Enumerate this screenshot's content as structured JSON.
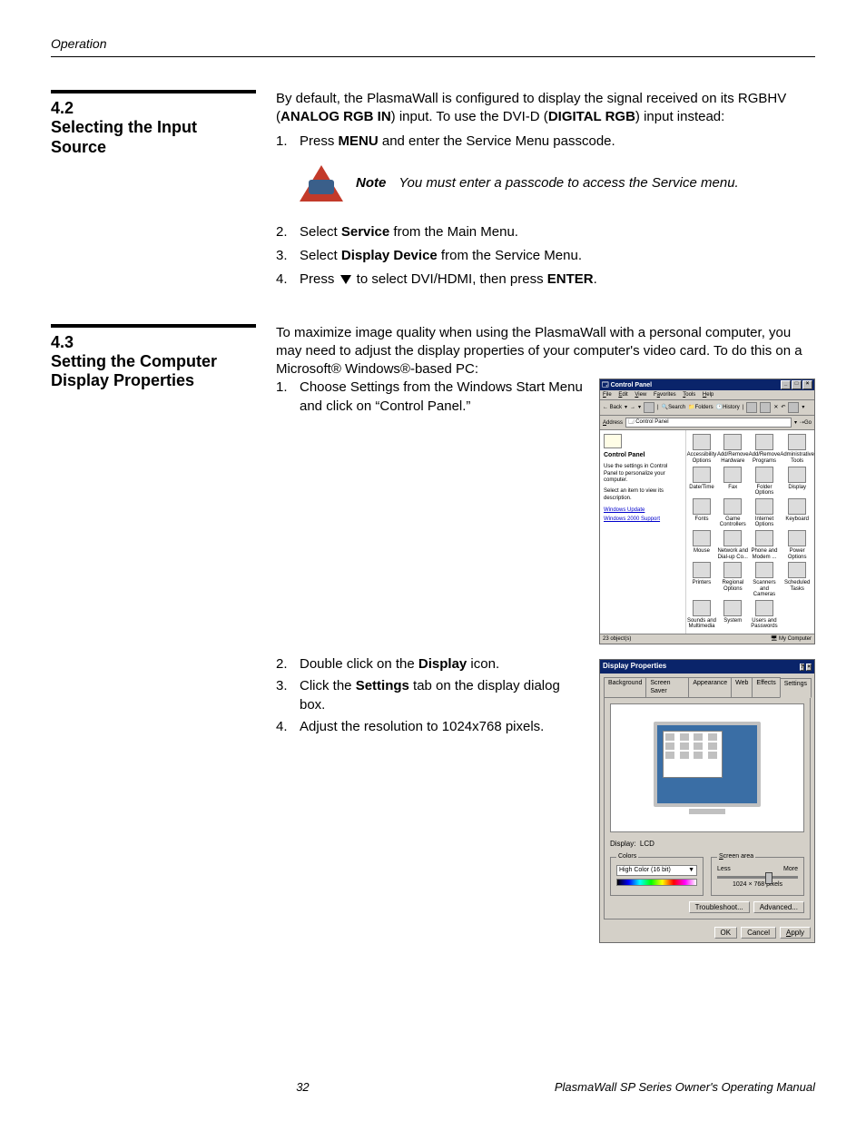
{
  "header": {
    "section": "Operation"
  },
  "sec42": {
    "num": "4.2",
    "title": "Selecting the Input Source",
    "intro_a": "By default, the PlasmaWall is configured to display the signal received on its RGBHV (",
    "intro_b": "ANALOG RGB IN",
    "intro_c": ") input. To use the DVI-D (",
    "intro_d": "DIGITAL RGB",
    "intro_e": ") input instead:",
    "step1_a": "Press ",
    "step1_b": "MENU",
    "step1_c": " and enter the Service Menu passcode.",
    "note_label": "Note",
    "note_text": "You must enter a passcode to access the Service menu.",
    "step2_a": "Select ",
    "step2_b": "Service",
    "step2_c": " from the Main Menu.",
    "step3_a": "Select ",
    "step3_b": "Display Device",
    "step3_c": " from the Service Menu.",
    "step4_a": "Press ",
    "step4_b": " to select DVI/HDMI, then press ",
    "step4_c": "ENTER",
    "step4_d": "."
  },
  "sec43": {
    "num": "4.3",
    "title": "Setting the Computer Display Properties",
    "intro": "To maximize image quality when using the PlasmaWall with a personal computer, you may need to adjust the display properties of your computer's video card. To do this on a Microsoft® Windows®-based PC:",
    "step1": "Choose Settings from the Windows Start Menu and click on “Control Panel.”",
    "step2_a": "Double click on the ",
    "step2_b": "Display",
    "step2_c": " icon.",
    "step3_a": "Click the ",
    "step3_b": "Settings",
    "step3_c": " tab on the display dialog box.",
    "step4": "Adjust the resolution to 1024x768 pixels."
  },
  "control_panel": {
    "title": "Control Panel",
    "menu": [
      "File",
      "Edit",
      "View",
      "Favorites",
      "Tools",
      "Help"
    ],
    "toolbar": {
      "back": "Back",
      "search": "Search",
      "folders": "Folders",
      "history": "History"
    },
    "address_label": "Address",
    "address_value": "Control Panel",
    "go": "Go",
    "side_heading": "Control Panel",
    "side_text1": "Use the settings in Control Panel to personalize your computer.",
    "side_text2": "Select an item to view its description.",
    "side_link1": "Windows Update",
    "side_link2": "Windows 2000 Support",
    "items": [
      "Accessibility Options",
      "Add/Remove Hardware",
      "Add/Remove Programs",
      "Administrative Tools",
      "Date/Time",
      "Fax",
      "Folder Options",
      "Display",
      "Fonts",
      "Game Controllers",
      "Internet Options",
      "Keyboard",
      "Mouse",
      "Network and Dial-up Co...",
      "Phone and Modem ...",
      "Power Options",
      "Printers",
      "Regional Options",
      "Scanners and Cameras",
      "Scheduled Tasks",
      "Sounds and Multimedia",
      "System",
      "Users and Passwords"
    ],
    "status_left": "23 object(s)",
    "status_right": "My Computer"
  },
  "display_props": {
    "title": "Display Properties",
    "tabs": [
      "Background",
      "Screen Saver",
      "Appearance",
      "Web",
      "Effects",
      "Settings"
    ],
    "display_label": "Display:",
    "display_value": "LCD",
    "colors_label": "Colors",
    "colors_value": "High Color (16 bit)",
    "screen_area_label": "Screen area",
    "less": "Less",
    "more": "More",
    "resolution": "1024 × 768 pixels",
    "troubleshoot": "Troubleshoot...",
    "advanced": "Advanced...",
    "ok": "OK",
    "cancel": "Cancel",
    "apply": "Apply"
  },
  "footer": {
    "page": "32",
    "title": "PlasmaWall SP Series Owner's Operating Manual"
  }
}
